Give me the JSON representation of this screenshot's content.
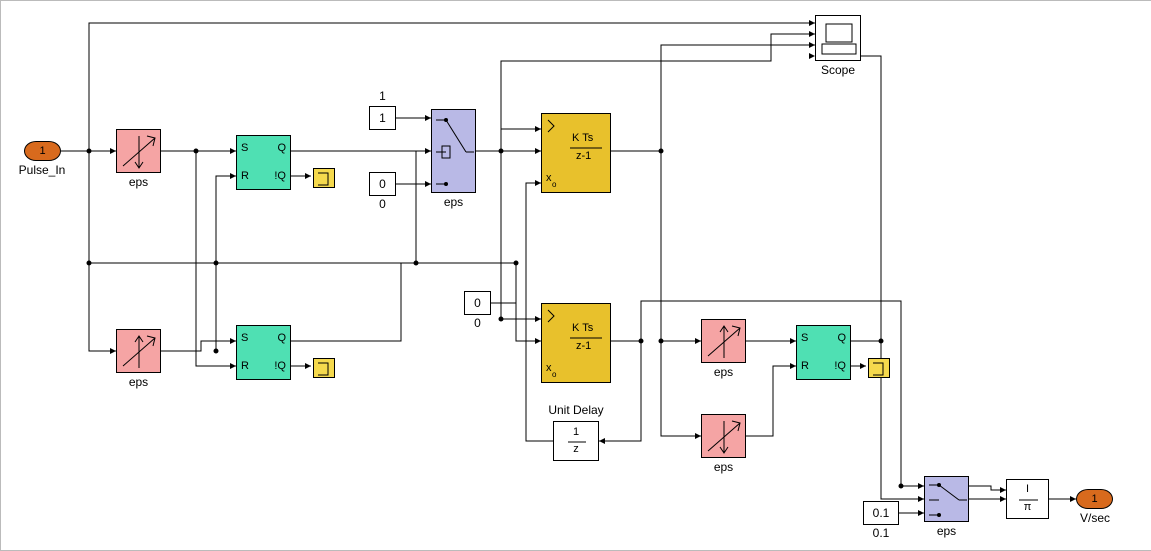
{
  "inport": {
    "num": "1",
    "name": "Pulse_In"
  },
  "outport": {
    "num": "1",
    "name": "V/sec"
  },
  "scope": {
    "name": "Scope"
  },
  "detect": {
    "fall_top": {
      "label": "eps"
    },
    "rise_bot": {
      "label": "eps"
    },
    "rise_r": {
      "label": "eps"
    },
    "fall_r": {
      "label": "eps"
    }
  },
  "sr": {
    "S": "S",
    "Q": "Q",
    "R": "R",
    "nQ": "!Q"
  },
  "const1": {
    "val": "1",
    "label": "1"
  },
  "const0a": {
    "val": "0",
    "label": "0"
  },
  "const0b": {
    "val": "0",
    "label": "0"
  },
  "const01": {
    "val": "0.1",
    "label": "0.1"
  },
  "switch": {
    "label": "eps"
  },
  "switch2": {
    "label": "eps"
  },
  "integ": {
    "x0": "x",
    "o": "o",
    "expr_top": "K Ts",
    "expr_bot": "z-1"
  },
  "unitdelay": {
    "name": "Unit Delay",
    "expr_top": "1",
    "expr_bot": "z"
  },
  "divide": {
    "sym_top": "I",
    "sym_bot": "π"
  },
  "chart_data": {
    "type": "diagram",
    "title": "",
    "nodes": [
      {
        "id": "in1",
        "type": "inport",
        "label": "Pulse_In",
        "value": "1"
      },
      {
        "id": "df1",
        "type": "detect_fall",
        "param": "eps"
      },
      {
        "id": "dr1",
        "type": "detect_rise",
        "param": "eps"
      },
      {
        "id": "sr1",
        "type": "sr_flipflop"
      },
      {
        "id": "sr2",
        "type": "sr_flipflop"
      },
      {
        "id": "t1",
        "type": "terminator"
      },
      {
        "id": "t2",
        "type": "terminator"
      },
      {
        "id": "c1",
        "type": "constant",
        "value": 1
      },
      {
        "id": "c0a",
        "type": "constant",
        "value": 0
      },
      {
        "id": "sw1",
        "type": "switch",
        "param": "eps"
      },
      {
        "id": "int1",
        "type": "disc_integrator",
        "expr": "K Ts/(z-1)",
        "reset": true,
        "ic_port": "x0"
      },
      {
        "id": "c0b",
        "type": "constant",
        "value": 0
      },
      {
        "id": "int2",
        "type": "disc_integrator",
        "expr": "K Ts/(z-1)",
        "reset": true,
        "ic_port": "x0"
      },
      {
        "id": "ud",
        "type": "unit_delay",
        "expr": "1/z",
        "label": "Unit Delay"
      },
      {
        "id": "dr2",
        "type": "detect_rise",
        "param": "eps"
      },
      {
        "id": "df2",
        "type": "detect_fall",
        "param": "eps"
      },
      {
        "id": "sr3",
        "type": "sr_flipflop"
      },
      {
        "id": "t3",
        "type": "terminator"
      },
      {
        "id": "c01",
        "type": "constant",
        "value": 0.1
      },
      {
        "id": "sw2",
        "type": "switch",
        "param": "eps"
      },
      {
        "id": "div",
        "type": "divide"
      },
      {
        "id": "scope",
        "type": "scope",
        "inputs": 4,
        "label": "Scope"
      },
      {
        "id": "out1",
        "type": "outport",
        "label": "V/sec",
        "value": "1"
      }
    ],
    "edges": [
      [
        "in1",
        "df1"
      ],
      [
        "in1",
        "dr1"
      ],
      [
        "in1",
        "scope:1"
      ],
      [
        "df1",
        "sr1:S"
      ],
      [
        "df1",
        "sr2:R"
      ],
      [
        "dr1",
        "sr1:R"
      ],
      [
        "dr1",
        "sr2:S"
      ],
      [
        "sr1:!Q",
        "t1"
      ],
      [
        "sr2:!Q",
        "t2"
      ],
      [
        "sr1:Q",
        "sw1:ctrl"
      ],
      [
        "sr1:Q",
        "int1:reset"
      ],
      [
        "sr2:Q",
        "int2:reset"
      ],
      [
        "c1",
        "sw1:in1"
      ],
      [
        "c0a",
        "sw1:in3"
      ],
      [
        "sw1",
        "int1:u"
      ],
      [
        "sw1",
        "int2:u"
      ],
      [
        "sw1",
        "scope:2"
      ],
      [
        "c0b",
        "int2:x0"
      ],
      [
        "int1",
        "scope:3"
      ],
      [
        "int1",
        "dr2"
      ],
      [
        "int1",
        "df2"
      ],
      [
        "int2",
        "ud"
      ],
      [
        "int2",
        "sw2:in1"
      ],
      [
        "int2",
        "div:num"
      ],
      [
        "ud",
        "int1:x0"
      ],
      [
        "dr2",
        "sr3:S"
      ],
      [
        "df2",
        "sr3:R"
      ],
      [
        "sr3:!Q",
        "t3"
      ],
      [
        "sr3:Q",
        "sw2:ctrl"
      ],
      [
        "sr3:Q",
        "scope:4"
      ],
      [
        "c01",
        "sw2:in3"
      ],
      [
        "sw2",
        "div:den"
      ],
      [
        "div",
        "out1"
      ]
    ]
  }
}
